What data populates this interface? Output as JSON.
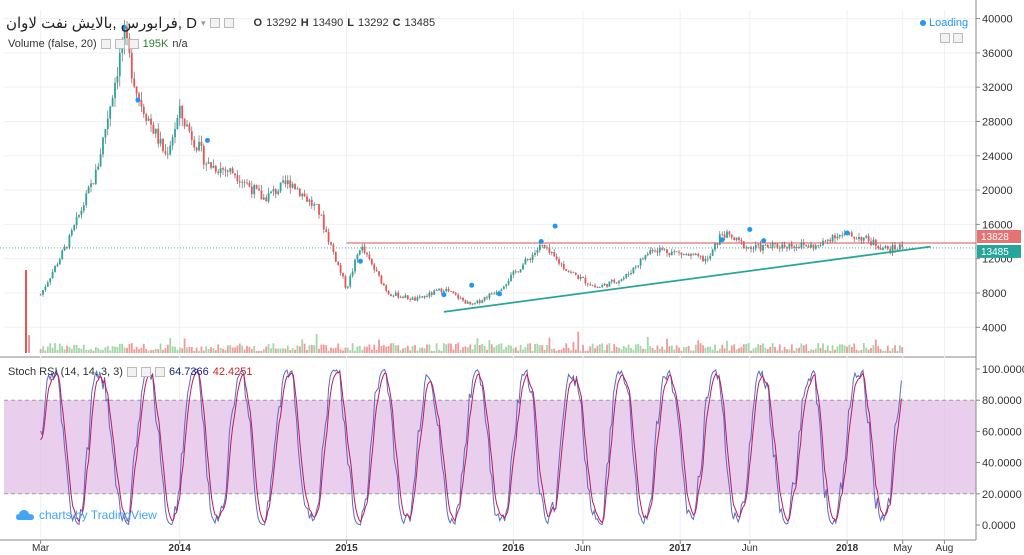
{
  "legend": {
    "symbol": "فرابورس ,بالایش نفت لاوان, D",
    "ohlc": [
      {
        "k": "O",
        "v": "13292"
      },
      {
        "k": "H",
        "v": "13490"
      },
      {
        "k": "L",
        "v": "13292"
      },
      {
        "k": "C",
        "v": "13485"
      }
    ],
    "volume_label": "Volume (false, 20)",
    "volume_value": "195K",
    "volume_extra": "n/a",
    "stoch_label": "Stoch RSI (14, 14, 3, 3)",
    "stoch_k": "64.7366",
    "stoch_d": "42.4251"
  },
  "loading": "Loading",
  "branding": "charts by TradingView",
  "colors": {
    "candle_up": "#26a69a",
    "candle_down": "#ef5350",
    "trend_line": "#26a69a",
    "resistance": "#e57373",
    "rsi_k": "#5c6bc0",
    "rsi_d": "#c2185b",
    "rsi_band": "#e1bee7",
    "marker": "#2196f3"
  },
  "chart_data": [
    {
      "type": "line",
      "panel": "price",
      "y_ticks": [
        40000,
        36000,
        32000,
        28000,
        24000,
        20000,
        16000,
        12000,
        8000,
        4000
      ],
      "ylim": [
        1000,
        41000
      ],
      "x_ticks": [
        "Mar",
        "2014",
        "2015",
        "2016",
        "Jun",
        "2017",
        "Jun",
        "2018",
        "May",
        "Aug"
      ],
      "price_labels": [
        {
          "label": "13828",
          "value": 13828
        },
        {
          "label": "13485",
          "value": 13485
        }
      ],
      "approx_close": [
        {
          "x": "Mar 2013",
          "y": 7800
        },
        {
          "x": "May 2013",
          "y": 14000
        },
        {
          "x": "Jul 2013",
          "y": 22000
        },
        {
          "x": "Sep 2013",
          "y": 38000
        },
        {
          "x": "Oct 2013",
          "y": 31000
        },
        {
          "x": "Dec 2013",
          "y": 24000
        },
        {
          "x": "Jan 2014",
          "y": 29000
        },
        {
          "x": "Mar 2014",
          "y": 23000
        },
        {
          "x": "May 2014",
          "y": 22000
        },
        {
          "x": "Jul 2014",
          "y": 19000
        },
        {
          "x": "Sep 2014",
          "y": 21000
        },
        {
          "x": "Nov 2014",
          "y": 17500
        },
        {
          "x": "Jan 2015",
          "y": 8500
        },
        {
          "x": "Feb 2015",
          "y": 13500
        },
        {
          "x": "Apr 2015",
          "y": 8000
        },
        {
          "x": "Jun 2015",
          "y": 7200
        },
        {
          "x": "Aug 2015",
          "y": 8500
        },
        {
          "x": "Oct 2015",
          "y": 6500
        },
        {
          "x": "Dec 2015",
          "y": 8500
        },
        {
          "x": "Mar 2016",
          "y": 13500
        },
        {
          "x": "May 2016",
          "y": 10500
        },
        {
          "x": "Jul 2016",
          "y": 8600
        },
        {
          "x": "Sep 2016",
          "y": 9800
        },
        {
          "x": "Nov 2016",
          "y": 13200
        },
        {
          "x": "Jan 2017",
          "y": 12600
        },
        {
          "x": "Mar 2017",
          "y": 11800
        },
        {
          "x": "Apr 2017",
          "y": 15000
        },
        {
          "x": "Jun 2017",
          "y": 13200
        },
        {
          "x": "Sep 2017",
          "y": 13600
        },
        {
          "x": "Nov 2017",
          "y": 13400
        },
        {
          "x": "Dec 2017",
          "y": 14800
        },
        {
          "x": "Feb 2018",
          "y": 14500
        },
        {
          "x": "Apr 2018",
          "y": 13000
        },
        {
          "x": "May 2018",
          "y": 13485
        }
      ],
      "resistance_level": 13828,
      "trendline": [
        {
          "x": "Aug 2015",
          "y": 5800
        },
        {
          "x": "Jul 2018",
          "y": 13400
        }
      ]
    },
    {
      "type": "line",
      "panel": "stoch_rsi",
      "y_ticks": [
        100,
        80,
        60,
        40,
        20,
        0
      ],
      "y_tick_labels": [
        "100.0000",
        "80.0000",
        "60.0000",
        "40.0000",
        "20.0000",
        "0.0000"
      ],
      "ylim": [
        0,
        100
      ],
      "band": [
        20,
        80
      ],
      "series": [
        {
          "values_k": [
            64.7366
          ],
          "values_d": [
            42.4251
          ]
        }
      ]
    }
  ]
}
